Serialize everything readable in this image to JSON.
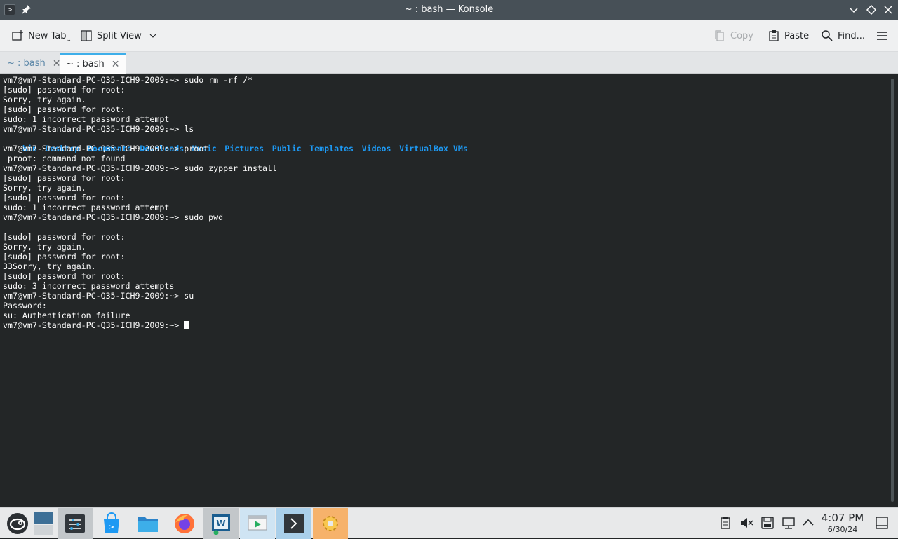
{
  "window": {
    "title": "~ : bash — Konsole",
    "app_icon": "konsole-icon",
    "pin_icon": "pin-icon",
    "controls": [
      "minimize-icon",
      "maximize-icon",
      "close-icon"
    ]
  },
  "toolbar": {
    "new_tab_label": "New Tab",
    "split_view_label": "Split View",
    "copy_label": "Copy",
    "paste_label": "Paste",
    "find_label": "Find...",
    "menu_icon": "hamburger-menu-icon"
  },
  "tabs": [
    {
      "label": "~ : bash",
      "active": false
    },
    {
      "label": "~ : bash",
      "active": true
    }
  ],
  "terminal": {
    "lines": [
      "vm7@vm7-Standard-PC-Q35-ICH9-2009:~> sudo rm -rf /*",
      "[sudo] password for root:",
      "Sorry, try again.",
      "[sudo] password for root:",
      "sudo: 1 incorrect password attempt",
      "vm7@vm7-Standard-PC-Q35-ICH9-2009:~> ls"
    ],
    "ls_output": [
      "bin",
      "Desktop",
      "Documents",
      "Downloads",
      "Music",
      "Pictures",
      "Public",
      "Templates",
      "Videos",
      "VirtualBox VMs"
    ],
    "lines_after": [
      "vm7@vm7-Standard-PC-Q35-ICH9-2009:~> proot",
      " proot: command not found",
      "vm7@vm7-Standard-PC-Q35-ICH9-2009:~> sudo zypper install",
      "[sudo] password for root:",
      "Sorry, try again.",
      "[sudo] password for root:",
      "sudo: 1 incorrect password attempt",
      "vm7@vm7-Standard-PC-Q35-ICH9-2009:~> sudo pwd",
      "",
      "[sudo] password for root:",
      "Sorry, try again.",
      "[sudo] password for root:",
      "33Sorry, try again.",
      "[sudo] password for root:",
      "sudo: 3 incorrect password attempts",
      "vm7@vm7-Standard-PC-Q35-ICH9-2009:~> su",
      "Password:",
      "su: Authentication failure"
    ],
    "prompt": "vm7@vm7-Standard-PC-Q35-ICH9-2009:~> ",
    "colors": {
      "background": "#232627",
      "foreground": "#fcfcfc",
      "directory": "#1d99f3"
    }
  },
  "taskbar": {
    "items": [
      "opensuse-start-icon",
      "desktop-pager-icon",
      "system-monitor-icon",
      "software-store-icon",
      "file-manager-icon",
      "firefox-icon",
      "vmware-icon",
      "virtualbox-icon",
      "terminal-icon",
      "settings-gear-icon"
    ],
    "tray": [
      "clipboard-icon",
      "volume-muted-icon",
      "storage-icon",
      "network-icon",
      "expand-tray-icon"
    ],
    "time": "4:07 PM",
    "date": "6/30/24",
    "show_desktop_icon": "show-desktop-icon"
  }
}
